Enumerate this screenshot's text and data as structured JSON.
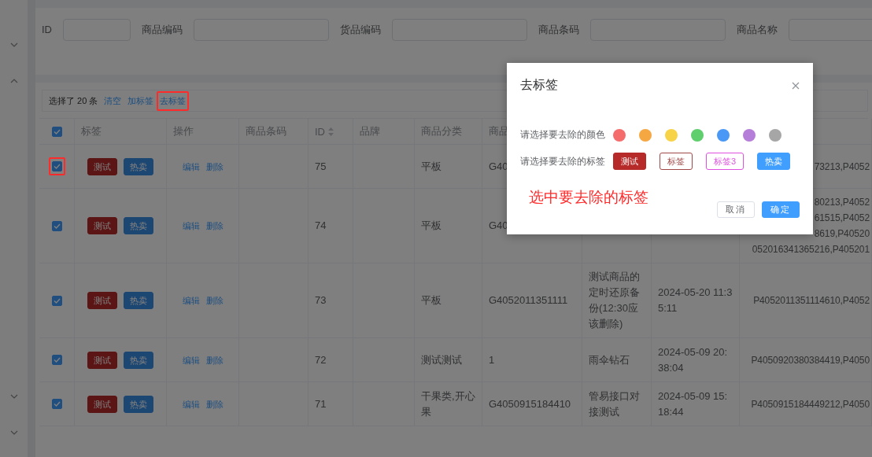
{
  "sidebar": {
    "toggles": [
      {
        "expanded": false
      },
      {
        "expanded": true
      },
      {
        "expanded": false
      },
      {
        "expanded": false
      }
    ]
  },
  "filters": [
    {
      "label": "ID"
    },
    {
      "label": "商品编码"
    },
    {
      "label": "货品编码"
    },
    {
      "label": "商品条码"
    },
    {
      "label": "商品名称"
    }
  ],
  "selection": {
    "text": "选择了 20 条",
    "actions": [
      {
        "label": "清空",
        "highlighted": false
      },
      {
        "label": "加标签",
        "highlighted": false
      },
      {
        "label": "去标签",
        "highlighted": true
      }
    ]
  },
  "table": {
    "all_checked": true,
    "columns": [
      "",
      "标签",
      "操作",
      "商品条码",
      "ID",
      "品牌",
      "商品分类",
      "商品"
    ],
    "rows": [
      {
        "checked": true,
        "highlighted": true,
        "tags": [
          {
            "label": "测试",
            "kind": "danger"
          },
          {
            "label": "热卖",
            "kind": "primary"
          }
        ],
        "actions": [
          "编辑",
          "删除"
        ],
        "id": "75",
        "category": "平板",
        "product": "G40",
        "codes": [
          "73213,P4052"
        ]
      },
      {
        "checked": true,
        "highlighted": false,
        "tags": [
          {
            "label": "测试",
            "kind": "danger"
          },
          {
            "label": "热卖",
            "kind": "primary"
          }
        ],
        "actions": [
          "编辑",
          "删除"
        ],
        "id": "74",
        "category": "平板",
        "product": "G40",
        "codes": [
          "80213,P4052",
          "61515,P4052",
          "8619,P40520",
          "052016341365216,P405201"
        ]
      },
      {
        "checked": true,
        "highlighted": false,
        "tags": [
          {
            "label": "测试",
            "kind": "danger"
          },
          {
            "label": "热卖",
            "kind": "primary"
          }
        ],
        "actions": [
          "编辑",
          "删除"
        ],
        "id": "73",
        "category": "平板",
        "product": "G4052011351111",
        "name": "测试商品的定时还原备份(12:30应该删除)",
        "date": "2024-05-20 11:35:11",
        "codes": [
          "P4052011351114610,P4052"
        ]
      },
      {
        "checked": true,
        "highlighted": false,
        "tags": [
          {
            "label": "测试",
            "kind": "danger"
          },
          {
            "label": "热卖",
            "kind": "primary"
          }
        ],
        "actions": [
          "编辑",
          "删除"
        ],
        "id": "72",
        "category": "测试测试",
        "product": "1",
        "name": "雨伞钻石",
        "date": "2024-05-09 20:38:04",
        "codes": [
          "P4050920380384419,P4050"
        ]
      },
      {
        "checked": true,
        "highlighted": false,
        "tags": [
          {
            "label": "测试",
            "kind": "danger"
          },
          {
            "label": "热卖",
            "kind": "primary"
          }
        ],
        "actions": [
          "编辑",
          "删除"
        ],
        "id": "71",
        "category": "干果类,开心果",
        "product": "G4050915184410",
        "name": "管易接口对接测试",
        "date": "2024-05-09 15:18:44",
        "codes": [
          "P4050915184449212,P4050"
        ]
      }
    ]
  },
  "dialog": {
    "title": "去标签",
    "color_label": "请选择要去除的颜色",
    "colors": [
      {
        "color": "#f56c6c"
      },
      {
        "color": "#f5a742"
      },
      {
        "color": "#f7d348"
      },
      {
        "color": "#5fce6c"
      },
      {
        "color": "#4a98f5"
      },
      {
        "color": "#b57ed8"
      },
      {
        "color": "#a6a6a6"
      }
    ],
    "tag_label": "请选择要去除的标签",
    "tags": [
      {
        "label": "测试",
        "kind": "filled",
        "color": "#b72a2a"
      },
      {
        "label": "标签",
        "kind": "outlined",
        "color": "#a04848"
      },
      {
        "label": "标签3",
        "kind": "outlined",
        "color": "#e050e0"
      },
      {
        "label": "热卖",
        "kind": "filled",
        "color": "#409eff"
      }
    ],
    "annotation": "选中要去除的标签",
    "buttons": [
      {
        "label": "取消",
        "kind": "default"
      },
      {
        "label": "确定",
        "kind": "primary"
      }
    ]
  }
}
